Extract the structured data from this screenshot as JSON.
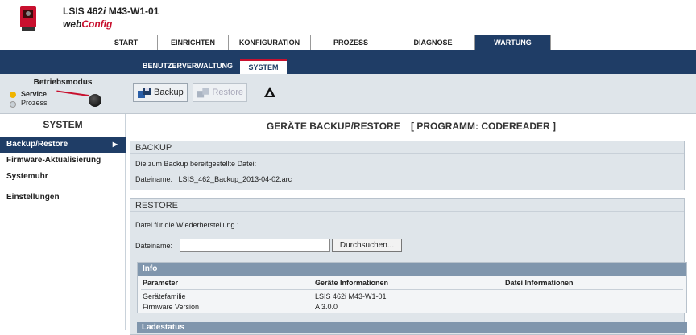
{
  "header": {
    "device_name_prefix": "LSIS 462",
    "device_name_italic": "i",
    "device_name_suffix": " M43-W1-01",
    "web_prefix": "web",
    "web_suffix": "Config"
  },
  "topnav": [
    "START",
    "EINRICHTEN",
    "KONFIGURATION",
    "PROZESS",
    "DIAGNOSE",
    "WARTUNG"
  ],
  "subnav": [
    "BENUTZERVERWALTUNG",
    "SYSTEM"
  ],
  "mode": {
    "title": "Betriebsmodus",
    "service": "Service",
    "prozess": "Prozess"
  },
  "sidebar": {
    "title": "SYSTEM",
    "items": [
      "Backup/Restore",
      "Firmware-Aktualisierung",
      "Systemuhr",
      "Einstellungen"
    ]
  },
  "toolbar": {
    "backup": "Backup",
    "restore": "Restore"
  },
  "page_title": "GERÄTE BACKUP/RESTORE    [ PROGRAMM: CODEREADER ]",
  "backup": {
    "header": "BACKUP",
    "line1": "Die zum Backup bereitgestellte Datei:",
    "line2_label": "Dateiname:",
    "line2_value": "LSIS_462_Backup_2013-04-02.arc"
  },
  "restore": {
    "header": "RESTORE",
    "line1": "Datei für die Wiederherstellung :",
    "file_label": "Dateiname:",
    "file_value": "",
    "browse": "Durchsuchen..."
  },
  "info": {
    "header": "Info",
    "col_param": "Parameter",
    "col_device": "Geräte Informationen",
    "col_file": "Datei Informationen",
    "rows": [
      {
        "param": "Gerätefamilie",
        "device": "LSIS 462i M43-W1-01",
        "file": ""
      },
      {
        "param": "Firmware Version",
        "device": "A 3.0.0",
        "file": ""
      }
    ]
  },
  "ladestatus": "Ladestatus",
  "colors": {
    "nav_dark": "#1f3d66",
    "accent_red": "#c8102e",
    "panel_bg": "#dfe5ea",
    "info_head": "#8096ad"
  }
}
